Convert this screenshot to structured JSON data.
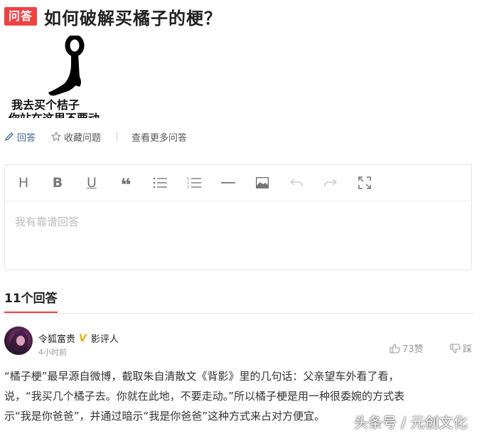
{
  "question": {
    "badge": "问答",
    "title": "如何破解买橘子的梗？"
  },
  "meme": {
    "caption_line1": "我去买个桔子",
    "caption_line2": "你站在这里不要动"
  },
  "actions": {
    "answer": "回答",
    "favorite": "收藏问题",
    "more": "查看更多问答"
  },
  "editor": {
    "placeholder": "我有靠谱回答",
    "tools": [
      "heading",
      "bold",
      "underline",
      "quote",
      "bullet-list",
      "numbered-list",
      "divider",
      "image",
      "undo",
      "redo",
      "fullscreen"
    ]
  },
  "answers": {
    "count_label": "11个回答"
  },
  "answer": {
    "author": "令狐富贵",
    "verified_mark": "V",
    "author_title": "影评人",
    "time": "4小时前",
    "likes": "73赞",
    "dislike": "踩",
    "lines": [
      "“橘子梗”最早源自微博，截取朱自清散文《背影》里的几句话：父亲望车外看了看，",
      "说，“我买几个橘子去。你就在此地，不要走动。”所以橘子梗是用一种很委婉的方式表",
      "示“我是你爸爸”，并通过暗示“我是你爸爸”这种方式来占对方便宜。"
    ]
  },
  "watermark": "头条号 / 元创文化",
  "colors": {
    "brand_red": "#f04142",
    "link_blue": "#406599",
    "verified_gold": "#e3b21a"
  }
}
